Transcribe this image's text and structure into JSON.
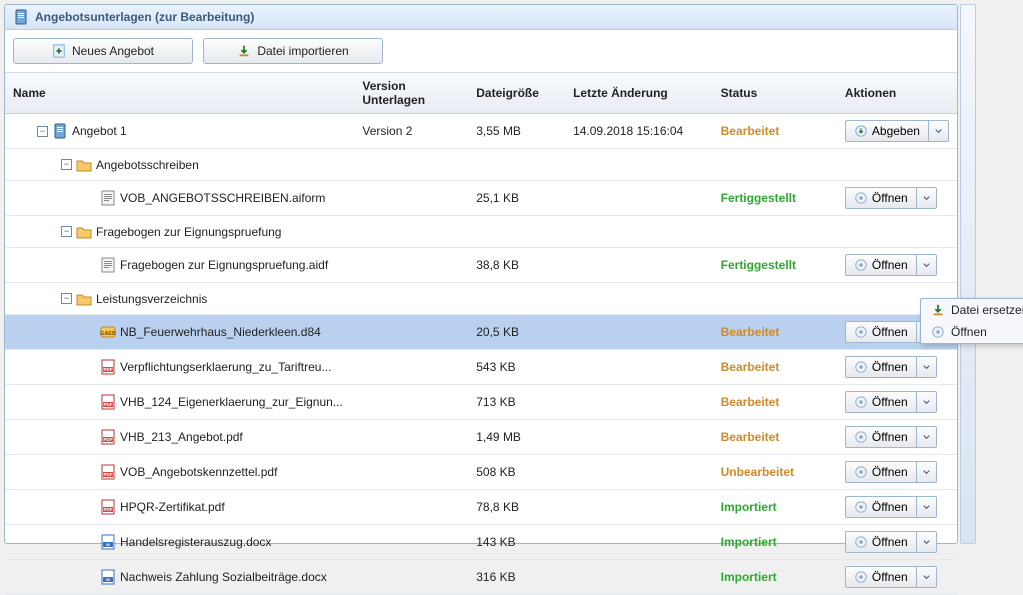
{
  "panel": {
    "title": "Angebotsunterlagen (zur Bearbeitung)"
  },
  "toolbar": {
    "new_offer": "Neues Angebot",
    "import_file": "Datei importieren"
  },
  "columns": {
    "name": "Name",
    "version": "Version Unterlagen",
    "size": "Dateigröße",
    "modified": "Letzte Änderung",
    "status": "Status",
    "actions": "Aktionen"
  },
  "actions": {
    "submit": "Abgeben",
    "open": "Öffnen"
  },
  "context_menu": {
    "replace": "Datei ersetzen",
    "open": "Öffnen"
  },
  "rows": [
    {
      "id": "root",
      "level": 1,
      "expander": true,
      "icon": "offer",
      "name": "Angebot 1",
      "version": "Version 2",
      "size": "3,55 MB",
      "modified": "14.09.2018 15:16:04",
      "status": "Bearbeitet",
      "action": "submit"
    },
    {
      "id": "grp1",
      "level": 2,
      "expander": true,
      "icon": "folder",
      "name": "Angebotsschreiben",
      "version": "",
      "size": "",
      "modified": "",
      "status": "",
      "action": ""
    },
    {
      "id": "f1",
      "level": 3,
      "expander": false,
      "icon": "form",
      "name": "VOB_ANGEBOTSSCHREIBEN.aiform",
      "version": "",
      "size": "25,1 KB",
      "modified": "",
      "status": "Fertiggestellt",
      "action": "open"
    },
    {
      "id": "grp2",
      "level": 2,
      "expander": true,
      "icon": "folder",
      "name": "Fragebogen zur Eignungspruefung",
      "version": "",
      "size": "",
      "modified": "",
      "status": "",
      "action": ""
    },
    {
      "id": "f2",
      "level": 3,
      "expander": false,
      "icon": "form",
      "name": "Fragebogen zur Eignungspruefung.aidf",
      "version": "",
      "size": "38,8 KB",
      "modified": "",
      "status": "Fertiggestellt",
      "action": "open"
    },
    {
      "id": "grp3",
      "level": 2,
      "expander": true,
      "icon": "folder",
      "name": "Leistungsverzeichnis",
      "version": "",
      "size": "",
      "modified": "",
      "status": "",
      "action": ""
    },
    {
      "id": "f3",
      "level": 3,
      "expander": false,
      "icon": "gaeb",
      "name": "NB_Feuerwehrhaus_Niederkleen.d84",
      "version": "",
      "size": "20,5 KB",
      "modified": "",
      "status": "Bearbeitet",
      "action": "open",
      "selected": true
    },
    {
      "id": "f4",
      "level": 3,
      "expander": false,
      "icon": "pdf",
      "name": "Verpflichtungserklaerung_zu_Tariftreu...",
      "version": "",
      "size": "543 KB",
      "modified": "",
      "status": "Bearbeitet",
      "action": "open"
    },
    {
      "id": "f5",
      "level": 3,
      "expander": false,
      "icon": "pdf",
      "name": "VHB_124_Eigenerklaerung_zur_Eignun...",
      "version": "",
      "size": "713 KB",
      "modified": "",
      "status": "Bearbeitet",
      "action": "open"
    },
    {
      "id": "f6",
      "level": 3,
      "expander": false,
      "icon": "pdf",
      "name": "VHB_213_Angebot.pdf",
      "version": "",
      "size": "1,49 MB",
      "modified": "",
      "status": "Bearbeitet",
      "action": "open"
    },
    {
      "id": "f7",
      "level": 3,
      "expander": false,
      "icon": "pdf",
      "name": "VOB_Angebotskennzettel.pdf",
      "version": "",
      "size": "508 KB",
      "modified": "",
      "status": "Unbearbeitet",
      "action": "open"
    },
    {
      "id": "f8",
      "level": 3,
      "expander": false,
      "icon": "pdf",
      "name": "HPQR-Zertifikat.pdf",
      "version": "",
      "size": "78,8 KB",
      "modified": "",
      "status": "Importiert",
      "action": "open"
    },
    {
      "id": "f9",
      "level": 3,
      "expander": false,
      "icon": "docx",
      "name": "Handelsregisterauszug.docx",
      "version": "",
      "size": "143 KB",
      "modified": "",
      "status": "Importiert",
      "action": "open"
    },
    {
      "id": "f10",
      "level": 3,
      "expander": false,
      "icon": "docx",
      "name": "Nachweis Zahlung Sozialbeiträge.docx",
      "version": "",
      "size": "316 KB",
      "modified": "",
      "status": "Importiert",
      "action": "open"
    }
  ]
}
